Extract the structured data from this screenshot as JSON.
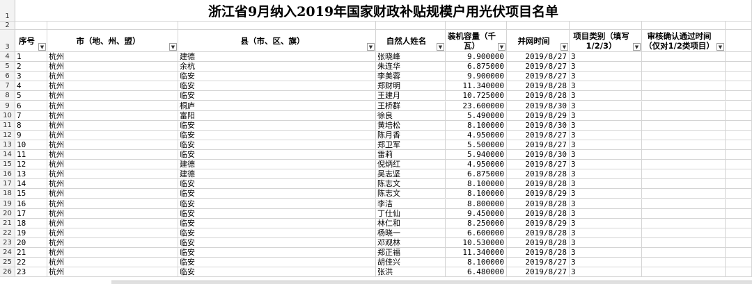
{
  "sheet": {
    "title": "浙江省9月纳入2019年国家财政补贴规模户用光伏项目名单",
    "row_numbers": [
      "1",
      "2",
      "3",
      "4",
      "5",
      "6",
      "7",
      "8",
      "9",
      "10",
      "11",
      "12",
      "13",
      "14",
      "15",
      "16",
      "17",
      "18",
      "19",
      "20",
      "21",
      "22",
      "23",
      "24",
      "25",
      "26"
    ],
    "headers": [
      "序号",
      "市（地、州、盟）",
      "县（市、区、旗）",
      "自然人姓名",
      "装机容量（千瓦）",
      "并网时间",
      "项目类别（填写1/2/3）",
      "审核确认通过时间（仅对1/2类项目）"
    ],
    "rows": [
      {
        "no": "1",
        "city": "杭州",
        "county": "建德",
        "name": "张晓峰",
        "cap": "9.900000",
        "date": "2019/8/27",
        "type": "3"
      },
      {
        "no": "2",
        "city": "杭州",
        "county": "余杭",
        "name": "朱连华",
        "cap": "6.875000",
        "date": "2019/8/27",
        "type": "3"
      },
      {
        "no": "3",
        "city": "杭州",
        "county": "临安",
        "name": "李美蓉",
        "cap": "9.900000",
        "date": "2019/8/27",
        "type": "3"
      },
      {
        "no": "4",
        "city": "杭州",
        "county": "临安",
        "name": "郑财明",
        "cap": "11.340000",
        "date": "2019/8/28",
        "type": "3"
      },
      {
        "no": "5",
        "city": "杭州",
        "county": "临安",
        "name": "王建月",
        "cap": "10.725000",
        "date": "2019/8/28",
        "type": "3"
      },
      {
        "no": "6",
        "city": "杭州",
        "county": "桐庐",
        "name": "王桥群",
        "cap": "23.600000",
        "date": "2019/8/30",
        "type": "3"
      },
      {
        "no": "7",
        "city": "杭州",
        "county": "富阳",
        "name": "徐良",
        "cap": "5.490000",
        "date": "2019/8/29",
        "type": "3"
      },
      {
        "no": "8",
        "city": "杭州",
        "county": "临安",
        "name": "黄培松",
        "cap": "8.100000",
        "date": "2019/8/30",
        "type": "3"
      },
      {
        "no": "9",
        "city": "杭州",
        "county": "临安",
        "name": "陈月香",
        "cap": "4.950000",
        "date": "2019/8/27",
        "type": "3"
      },
      {
        "no": "10",
        "city": "杭州",
        "county": "临安",
        "name": "郑卫军",
        "cap": "5.500000",
        "date": "2019/8/27",
        "type": "3"
      },
      {
        "no": "11",
        "city": "杭州",
        "county": "临安",
        "name": "雷莉",
        "cap": "5.940000",
        "date": "2019/8/30",
        "type": "3"
      },
      {
        "no": "12",
        "city": "杭州",
        "county": "建德",
        "name": "倪炳红",
        "cap": "4.950000",
        "date": "2019/8/27",
        "type": "3"
      },
      {
        "no": "13",
        "city": "杭州",
        "county": "建德",
        "name": "吴志坚",
        "cap": "6.875000",
        "date": "2019/8/28",
        "type": "3"
      },
      {
        "no": "14",
        "city": "杭州",
        "county": "临安",
        "name": "陈志文",
        "cap": "8.100000",
        "date": "2019/8/28",
        "type": "3"
      },
      {
        "no": "15",
        "city": "杭州",
        "county": "临安",
        "name": "陈志文",
        "cap": "8.100000",
        "date": "2019/8/29",
        "type": "3"
      },
      {
        "no": "16",
        "city": "杭州",
        "county": "临安",
        "name": "李洁",
        "cap": "8.800000",
        "date": "2019/8/28",
        "type": "3"
      },
      {
        "no": "17",
        "city": "杭州",
        "county": "临安",
        "name": "丁仕仙",
        "cap": "9.450000",
        "date": "2019/8/28",
        "type": "3"
      },
      {
        "no": "18",
        "city": "杭州",
        "county": "临安",
        "name": "林仁和",
        "cap": "8.250000",
        "date": "2019/8/29",
        "type": "3"
      },
      {
        "no": "19",
        "city": "杭州",
        "county": "临安",
        "name": "杨晓一",
        "cap": "6.600000",
        "date": "2019/8/28",
        "type": "3"
      },
      {
        "no": "20",
        "city": "杭州",
        "county": "临安",
        "name": "邓观林",
        "cap": "10.530000",
        "date": "2019/8/28",
        "type": "3"
      },
      {
        "no": "21",
        "city": "杭州",
        "county": "临安",
        "name": "郑正福",
        "cap": "11.340000",
        "date": "2019/8/28",
        "type": "3"
      },
      {
        "no": "22",
        "city": "杭州",
        "county": "临安",
        "name": "胡佳兴",
        "cap": "8.100000",
        "date": "2019/8/27",
        "type": "3"
      },
      {
        "no": "23",
        "city": "杭州",
        "county": "临安",
        "name": "张洪",
        "cap": "6.480000",
        "date": "2019/8/27",
        "type": "3"
      }
    ],
    "icons": {
      "filter": "dropdown-arrow-icon"
    },
    "colors": {
      "header_bg": "#f3f3f3",
      "grid": "#d4d4d4"
    }
  }
}
